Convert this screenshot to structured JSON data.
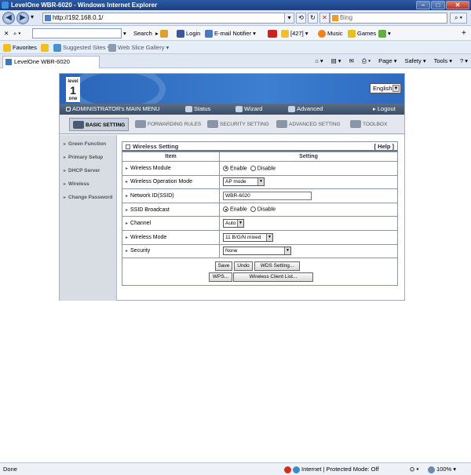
{
  "window": {
    "title": "LevelOne WBR-6020 - Windows Internet Explorer",
    "minimize": "–",
    "maximize": "□",
    "close": "✕"
  },
  "address_bar": {
    "url": "http://192.168.0.1/",
    "search_placeholder": "Bing",
    "back": "◀",
    "forward": "▶",
    "dropdown": "▾",
    "compat": "⟲",
    "refresh": "↻",
    "stop": "✕",
    "search_go": "⌕ ▾"
  },
  "toolbar": {
    "close_x": "✕",
    "search": "Search",
    "login": "Login",
    "email_notifier": "E-mail Notifier",
    "count": "[427]",
    "music": "Music",
    "games": "Games",
    "add": "+"
  },
  "favorites": {
    "label": "Favorites",
    "suggested": "Suggested Sites ▾",
    "gallery": "Web Slice Gallery ▾"
  },
  "tab": {
    "label": "LevelOne WBR-6020"
  },
  "command_bar": {
    "home": "⌂ ▾",
    "feeds": "▤ ▾",
    "mail": "✉",
    "print": "⎙ ▾",
    "page": "Page ▾",
    "safety": "Safety ▾",
    "tools": "Tools ▾",
    "help": "? ▾"
  },
  "router": {
    "logo_top": "level",
    "logo_mid": "1",
    "logo_bottom": "one",
    "language": "English",
    "main_menu": {
      "title": "ADMINISTRATOR's MAIN MENU",
      "status": "Status",
      "wizard": "Wizard",
      "advanced": "Advanced",
      "logout": "Logout"
    },
    "tabs": {
      "basic": "BASIC SETTING",
      "forwarding": "FORWARDING RULES",
      "security": "SECURITY SETTING",
      "advanced": "ADVANCED SETTING",
      "toolbox": "TOOLBOX"
    },
    "sidebar": {
      "green": "Green Function",
      "primary": "Primary Setup",
      "dhcp": "DHCP Server",
      "wireless": "Wireless",
      "password": "Change Password"
    },
    "panel": {
      "title": "Wireless Setting",
      "help": "[ Help ]",
      "col_item": "Item",
      "col_setting": "Setting",
      "enable": "Enable",
      "disable": "Disable",
      "rows": {
        "module": "Wireless Module",
        "op_mode": "Wireless Operation Mode",
        "ssid": "Network ID(SSID)",
        "broadcast": "SSID Broadcast",
        "channel": "Channel",
        "wmode": "Wireless Mode",
        "security": "Security"
      },
      "values": {
        "op_mode": "AP mode",
        "ssid": "WBR-6020",
        "channel": "Auto",
        "wmode": "11 B/G/N mixed",
        "security": "None"
      }
    },
    "buttons": {
      "save": "Save",
      "undo": "Undo",
      "wds": "WDS Setting...",
      "wps": "WPS...",
      "client_list": "Wireless Client List..."
    }
  },
  "status_bar": {
    "done": "Done",
    "zone": "Internet | Protected Mode: Off",
    "zoom": "100%"
  },
  "colors": {
    "router_header": "#2a64b8",
    "menu_bar": "#4a5c76",
    "sidebar": "#d8dde4"
  }
}
